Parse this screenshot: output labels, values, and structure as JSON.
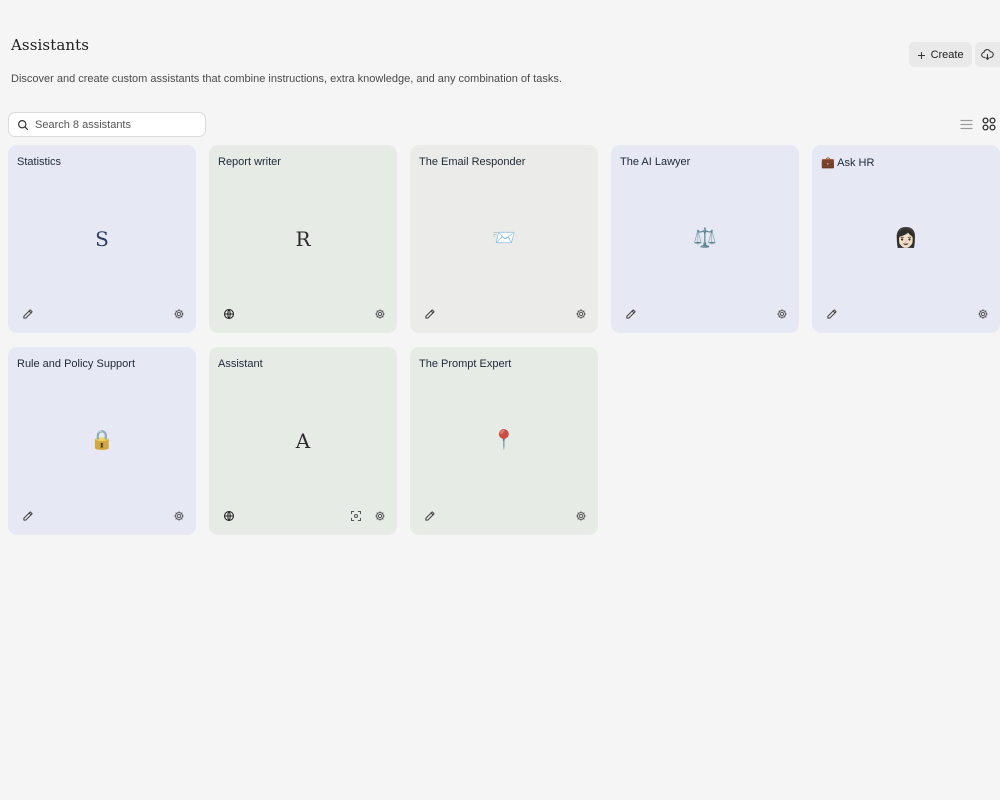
{
  "header": {
    "title": "Assistants",
    "description": "Discover and create custom assistants that combine instructions, extra knowledge, and any combination of tasks.",
    "create_label": "Create"
  },
  "search": {
    "placeholder": "Search 8 assistants",
    "value": ""
  },
  "view": {
    "active": "grid"
  },
  "cards": [
    {
      "title": "Statistics",
      "emblem": "S",
      "emblem_type": "letter",
      "theme": "lavender",
      "left_icon": "pencil-icon",
      "extra_icon": "",
      "right_icon": "gear-icon"
    },
    {
      "title": "Report writer",
      "emblem": "R",
      "emblem_type": "letter",
      "theme": "sage",
      "left_icon": "globe-icon",
      "extra_icon": "",
      "right_icon": "gear-icon"
    },
    {
      "title": "The Email Responder",
      "emblem": "📨",
      "emblem_type": "emoji",
      "theme": "warm",
      "left_icon": "pencil-icon",
      "extra_icon": "",
      "right_icon": "gear-icon"
    },
    {
      "title": "The AI Lawyer",
      "emblem": "⚖️",
      "emblem_type": "emoji",
      "theme": "lavender",
      "left_icon": "pencil-icon",
      "extra_icon": "",
      "right_icon": "gear-icon"
    },
    {
      "title": "💼 Ask HR",
      "emblem": "👩🏻",
      "emblem_type": "emoji",
      "theme": "lavender",
      "left_icon": "pencil-icon",
      "extra_icon": "",
      "right_icon": "gear-icon"
    },
    {
      "title": "Rule and Policy Support",
      "emblem": "🔒",
      "emblem_type": "emoji",
      "theme": "lavender",
      "left_icon": "pencil-icon",
      "extra_icon": "",
      "right_icon": "gear-icon"
    },
    {
      "title": "Assistant",
      "emblem": "A",
      "emblem_type": "letter",
      "theme": "sage",
      "left_icon": "globe-icon",
      "extra_icon": "focus-icon",
      "right_icon": "gear-icon"
    },
    {
      "title": "The Prompt Expert",
      "emblem": "📍",
      "emblem_type": "emoji",
      "theme": "sage",
      "left_icon": "pencil-icon",
      "extra_icon": "",
      "right_icon": "gear-icon"
    }
  ]
}
